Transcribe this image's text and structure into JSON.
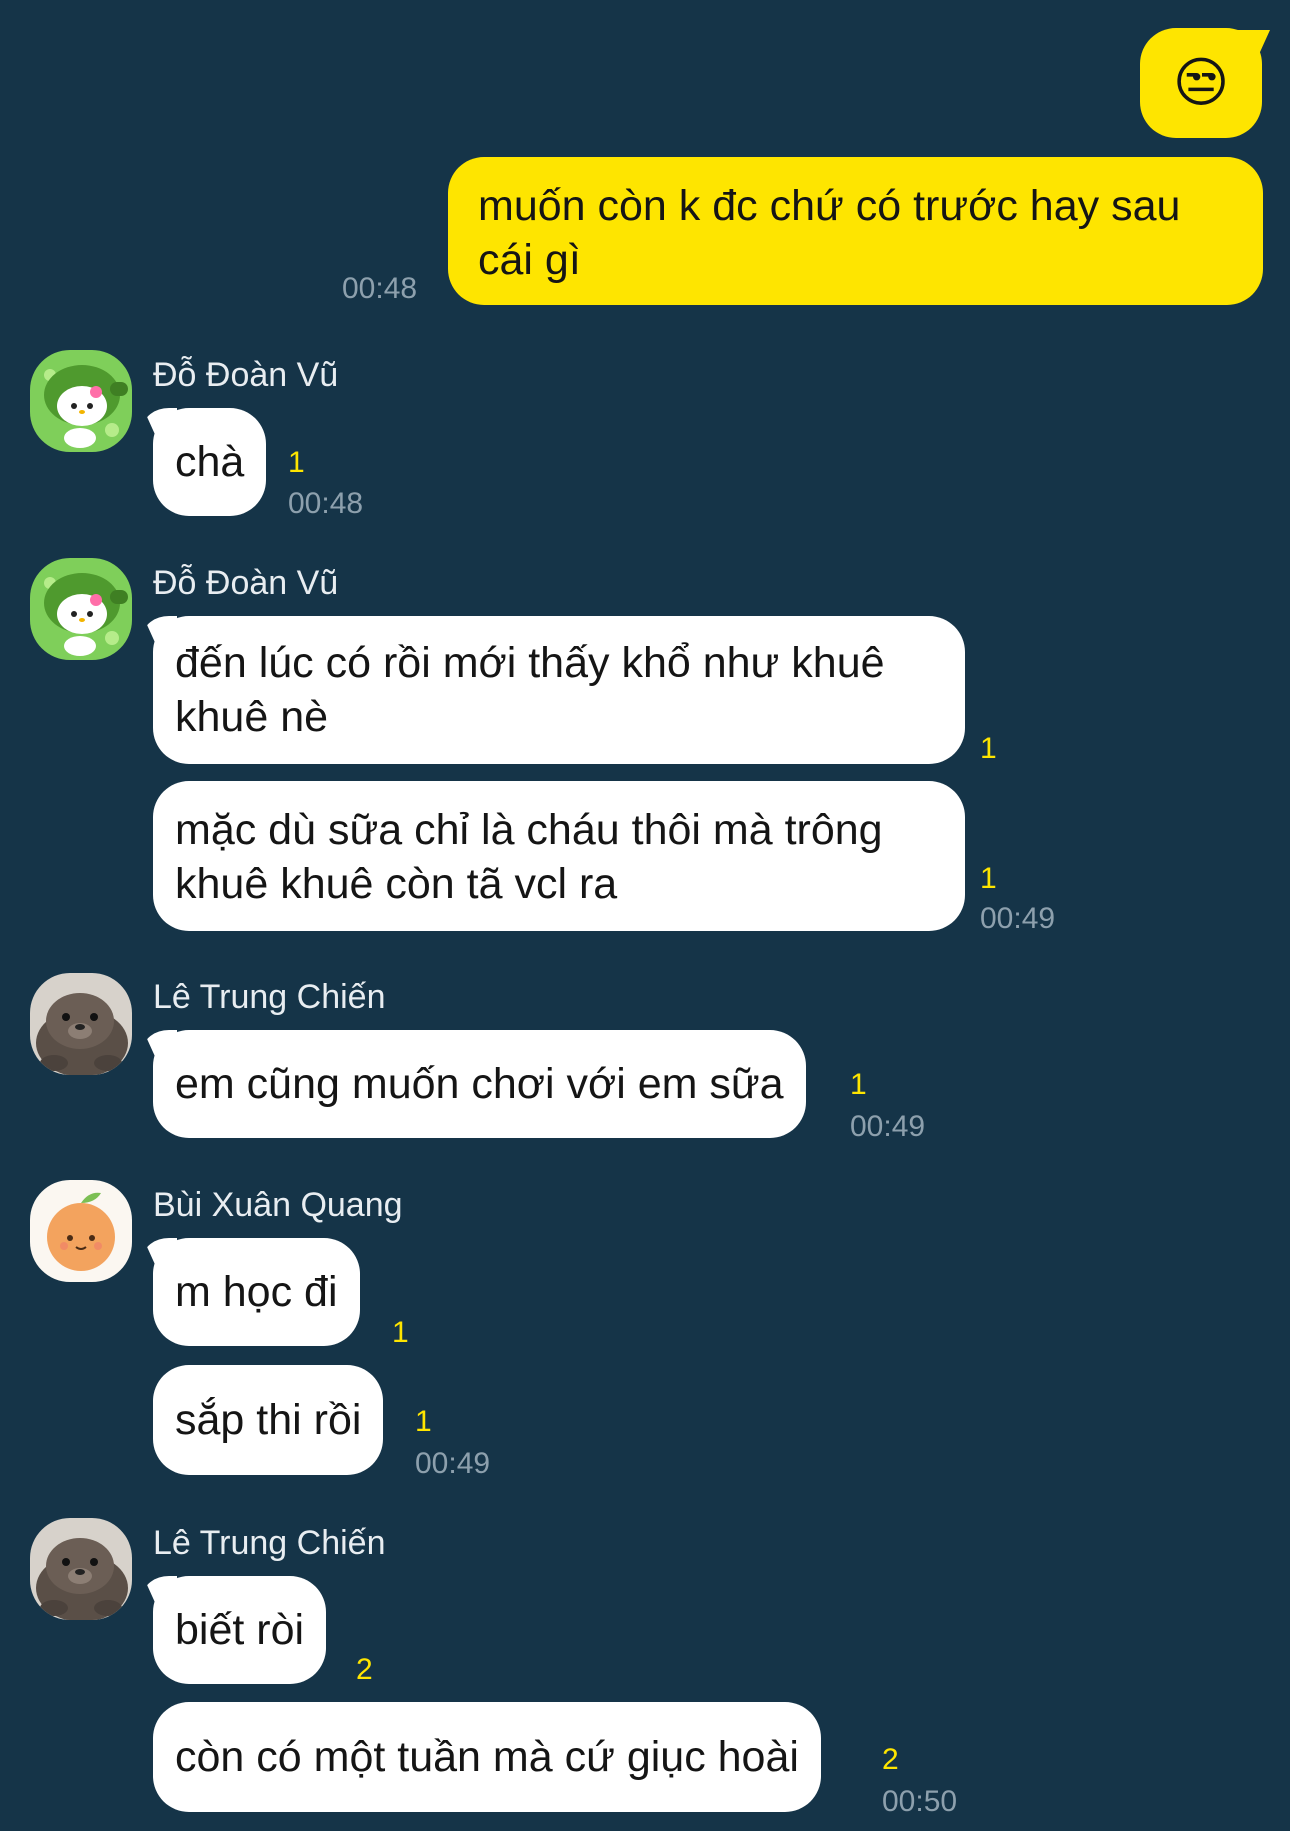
{
  "outgoing": {
    "emoji": "😒",
    "message": "muốn còn k đc chứ có trước hay sau cái gì",
    "time": "00:48"
  },
  "groups": [
    {
      "sender": "Đỗ Đoàn Vũ",
      "avatar_icon": "hello-kitty-plant-avatar",
      "messages": [
        {
          "text": "chà",
          "unread": "1",
          "time": "00:48"
        }
      ]
    },
    {
      "sender": "Đỗ Đoàn Vũ",
      "avatar_icon": "hello-kitty-plant-avatar",
      "messages": [
        {
          "text": "đến lúc có rồi mới thấy khổ như khuê khuê nè",
          "unread": "1"
        },
        {
          "text": "mặc dù sữa chỉ là cháu thôi mà trông khuê khuê còn tã vcl ra",
          "unread": "1",
          "time": "00:49"
        }
      ]
    },
    {
      "sender": "Lê Trung Chiến",
      "avatar_icon": "otter-avatar",
      "messages": [
        {
          "text": "em cũng muốn chơi với em sữa",
          "unread": "1",
          "time": "00:49"
        }
      ]
    },
    {
      "sender": "Bùi Xuân Quang",
      "avatar_icon": "orange-avatar",
      "messages": [
        {
          "text": "m học đi",
          "unread": "1"
        },
        {
          "text": "sắp thi rồi",
          "unread": "1",
          "time": "00:49"
        }
      ]
    },
    {
      "sender": "Lê Trung Chiến",
      "avatar_icon": "otter-avatar",
      "messages": [
        {
          "text": "biết ròi",
          "unread": "2"
        },
        {
          "text": "còn có một tuần mà cứ giục hoài",
          "unread": "2",
          "time": "00:50"
        }
      ]
    }
  ],
  "colors": {
    "background": "#153448",
    "outgoing_bubble": "#fee500",
    "incoming_bubble": "#ffffff",
    "unread_count": "#fee500",
    "timestamp": "#8da0ad"
  }
}
